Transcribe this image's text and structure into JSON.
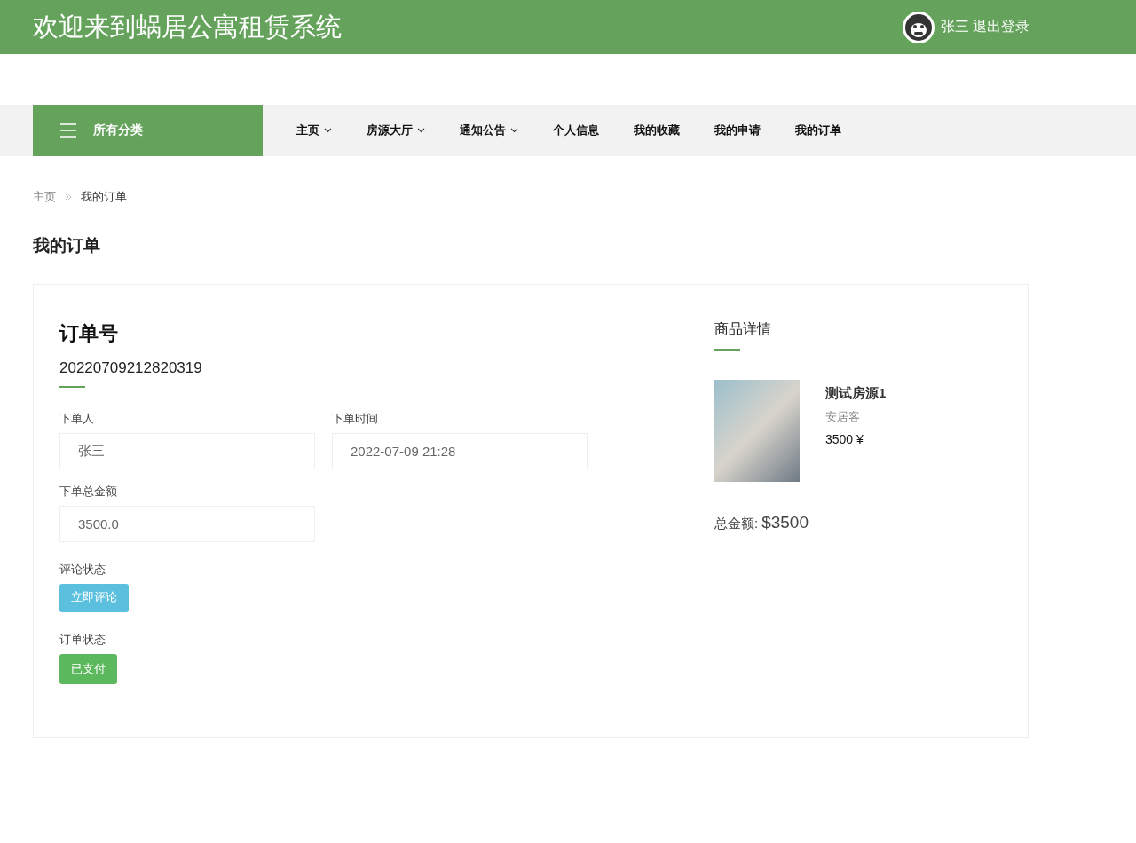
{
  "header": {
    "title": "欢迎来到蜗居公寓租赁系统",
    "user": "张三",
    "logout": "退出登录"
  },
  "nav": {
    "category": "所有分类",
    "items": [
      {
        "label": "主页",
        "dropdown": true
      },
      {
        "label": "房源大厅",
        "dropdown": true
      },
      {
        "label": "通知公告",
        "dropdown": true
      },
      {
        "label": "个人信息",
        "dropdown": false
      },
      {
        "label": "我的收藏",
        "dropdown": false
      },
      {
        "label": "我的申请",
        "dropdown": false
      },
      {
        "label": "我的订单",
        "dropdown": false
      }
    ]
  },
  "breadcrumb": [
    "主页",
    "我的订单"
  ],
  "page_title": "我的订单",
  "order": {
    "heading": "订单号",
    "number": "20220709212820319",
    "fields": [
      {
        "label": "下单人",
        "value": "张三"
      },
      {
        "label": "下单时间",
        "value": "2022-07-09 21:28"
      },
      {
        "label": "下单总金额",
        "value": "3500.0"
      }
    ],
    "statuses": [
      {
        "label": "评论状态",
        "button": "立即评论",
        "kind": "comment"
      },
      {
        "label": "订单状态",
        "button": "已支付",
        "kind": "paid"
      }
    ]
  },
  "product": {
    "heading": "商品详情",
    "name": "测试房源1",
    "seller": "安居客",
    "price": "3500 ¥",
    "total_label": "总金额:",
    "total": "$3500"
  }
}
